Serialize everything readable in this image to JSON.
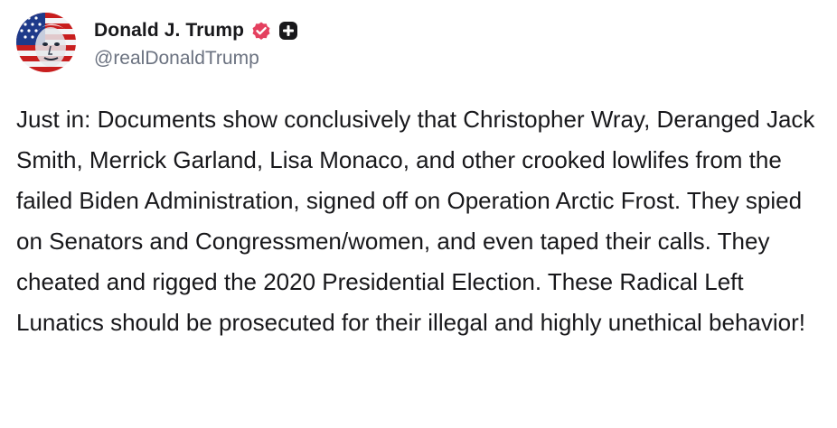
{
  "author": {
    "display_name": "Donald J. Trump",
    "handle": "@realDonaldTrump",
    "avatar_icon": "flag-portrait-avatar",
    "verified_icon": "verified-badge-icon",
    "verified_color": "#e4405f",
    "plus_icon": "plus-badge-icon"
  },
  "post": {
    "text": "Just in: Documents show conclusively that Christopher Wray, Deranged Jack Smith, Merrick Garland, Lisa Monaco, and other crooked lowlifes from the failed Biden Administration, signed off on Operation Arctic Frost. They spied on Senators and Congressmen/women, and even taped their calls. They cheated and rigged the 2020 Presidential Election. These Radical Left Lunatics should be prosecuted for their illegal and highly unethical behavior!"
  },
  "colors": {
    "text": "#18181b",
    "muted": "#6b7280",
    "badge_dark": "#18181b"
  }
}
